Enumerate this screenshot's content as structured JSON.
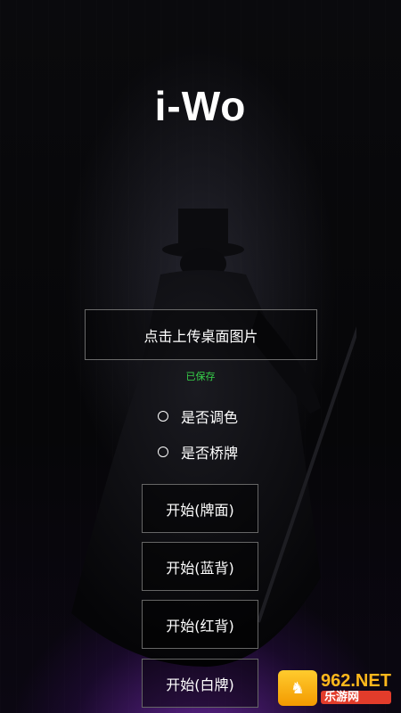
{
  "app": {
    "title": "i-Wo"
  },
  "upload": {
    "label": "点击上传桌面图片"
  },
  "status": {
    "saved": "已保存"
  },
  "options": [
    {
      "label": "是否调色"
    },
    {
      "label": "是否桥牌"
    }
  ],
  "buttons": [
    {
      "label": "开始(牌面)"
    },
    {
      "label": "开始(蓝背)"
    },
    {
      "label": "开始(红背)"
    },
    {
      "label": "开始(白牌)"
    }
  ],
  "watermark": {
    "top": "962.NET",
    "bottom": "乐游网"
  },
  "colors": {
    "saved": "#37d24a",
    "background": "#050507",
    "glow": "#aa3cff"
  }
}
